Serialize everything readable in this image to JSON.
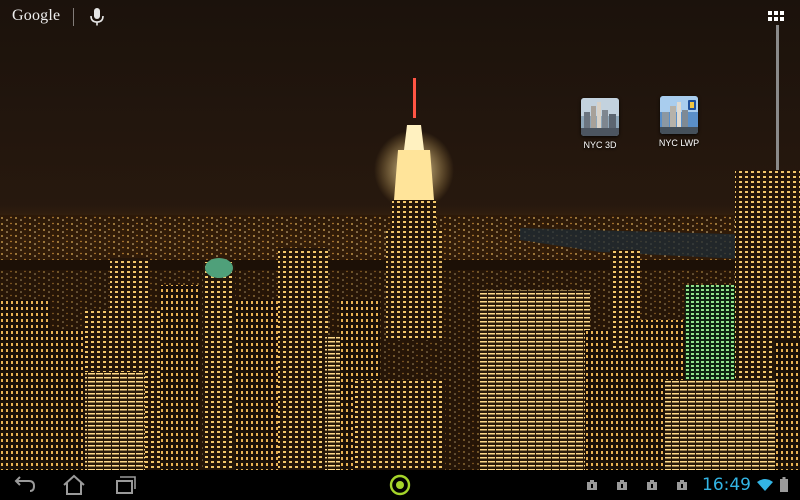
{
  "search": {
    "brand": "Google",
    "mic_icon": "mic-icon",
    "apps_icon": "all-apps-grid-icon"
  },
  "shortcuts": [
    {
      "label": "NYC 3D",
      "icon": "nyc-3d-app-icon"
    },
    {
      "label": "NYC LWP",
      "icon": "nyc-lwp-app-icon"
    }
  ],
  "navigation": {
    "buttons": [
      {
        "name": "back",
        "icon": "back-arrow-icon"
      },
      {
        "name": "home",
        "icon": "home-icon"
      },
      {
        "name": "recent-apps",
        "icon": "recent-apps-icon"
      }
    ],
    "center_icon": "target-ring-icon"
  },
  "status": {
    "time": "16:49",
    "notification_icons": [
      "download-icon",
      "download-icon",
      "download-icon",
      "download-icon"
    ],
    "wifi_icon": "wifi-icon",
    "battery_icon": "battery-icon"
  },
  "colors": {
    "clock": "#33b5e5",
    "accent_ring": "#a4d42a",
    "nav_bar": "#000000"
  }
}
